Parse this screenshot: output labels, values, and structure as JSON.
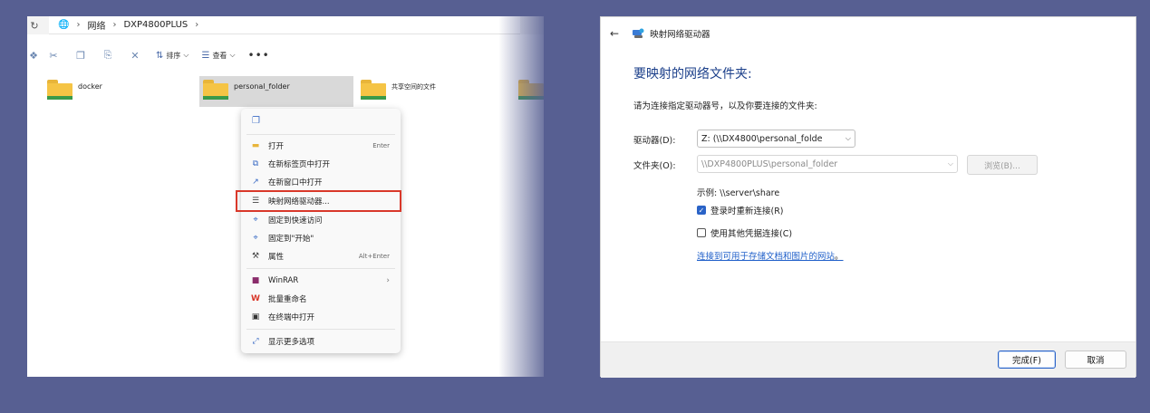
{
  "explorer": {
    "breadcrumb": [
      "网络",
      "DXP4800PLUS"
    ],
    "toolbar": {
      "sort_label": "排序",
      "view_label": "查看",
      "more_label": "•••"
    },
    "folders": [
      {
        "name": "docker"
      },
      {
        "name": "personal_folder"
      },
      {
        "name": "共享空间的文件"
      }
    ],
    "context_menu": {
      "items": [
        {
          "label": "打开",
          "shortcut": "Enter",
          "icon": "folder-icon"
        },
        {
          "label": "在新标签页中打开",
          "shortcut": "",
          "icon": "new-tab-icon"
        },
        {
          "label": "在新窗口中打开",
          "shortcut": "",
          "icon": "new-window-icon"
        },
        {
          "label": "映射网络驱动器...",
          "shortcut": "",
          "icon": "map-drive-icon",
          "highlighted": true
        },
        {
          "label": "固定到快速访问",
          "shortcut": "",
          "icon": "pin-icon"
        },
        {
          "label": "固定到\"开始\"",
          "shortcut": "",
          "icon": "pin-icon"
        },
        {
          "label": "属性",
          "shortcut": "Alt+Enter",
          "icon": "wrench-icon"
        },
        {
          "label": "WinRAR",
          "shortcut": "",
          "icon": "winrar-icon",
          "submenu": true
        },
        {
          "label": "批量重命名",
          "shortcut": "",
          "icon": "wps-icon"
        },
        {
          "label": "在终端中打开",
          "shortcut": "",
          "icon": "terminal-icon"
        },
        {
          "label": "显示更多选项",
          "shortcut": "",
          "icon": "more-options-icon"
        }
      ],
      "highlight_color": "#d9382a"
    }
  },
  "dialog": {
    "title": "映射网络驱动器",
    "heading": "要映射的网络文件夹:",
    "description": "请为连接指定驱动器号，以及你要连接的文件夹:",
    "drive_label": "驱动器(D):",
    "drive_value": "Z: (\\\\DX4800\\personal_folde",
    "folder_label": "文件夹(O):",
    "folder_value": "\\\\DXP4800PLUS\\personal_folder",
    "browse_label": "浏览(B)...",
    "example": "示例: \\\\server\\share",
    "reconnect_label": "登录时重新连接(R)",
    "reconnect_checked": true,
    "other_creds_label": "使用其他凭据连接(C)",
    "other_creds_checked": false,
    "link_text": "连接到可用于存储文档和图片的网站",
    "link_suffix": "。",
    "finish_label": "完成(F)",
    "cancel_label": "取消",
    "heading_color": "#1b3f8a",
    "accent_color": "#2a63c7"
  }
}
